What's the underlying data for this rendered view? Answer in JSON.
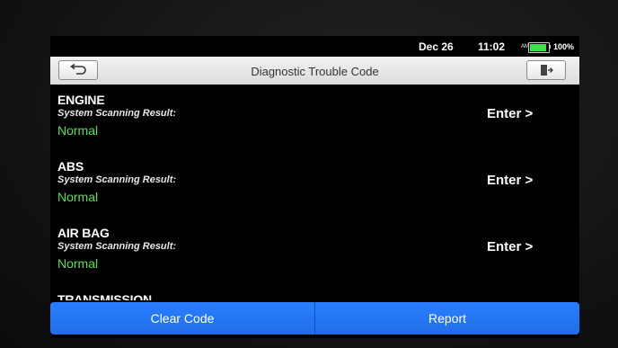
{
  "status_bar": {
    "date": "Dec 26",
    "time": "11:02",
    "ampm": "AM",
    "battery_percent": "100%",
    "battery_level": 1.0,
    "battery_color": "#3ee045"
  },
  "title_bar": {
    "title": "Diagnostic Trouble Code",
    "back_icon": "back-arrow-icon",
    "exit_icon": "exit-door-icon"
  },
  "systems": [
    {
      "name": "ENGINE",
      "scan_label": "System Scanning Result:",
      "status": "Normal",
      "action": "Enter >"
    },
    {
      "name": "ABS",
      "scan_label": "System Scanning Result:",
      "status": "Normal",
      "action": "Enter >"
    },
    {
      "name": "AIR BAG",
      "scan_label": "System Scanning Result:",
      "status": "Normal",
      "action": "Enter >"
    },
    {
      "name": "TRANSMISSION"
    }
  ],
  "buttons": {
    "clear_code": "Clear Code",
    "report": "Report"
  },
  "colors": {
    "status_normal": "#57e04f",
    "button_blue": "#2a7fff"
  }
}
